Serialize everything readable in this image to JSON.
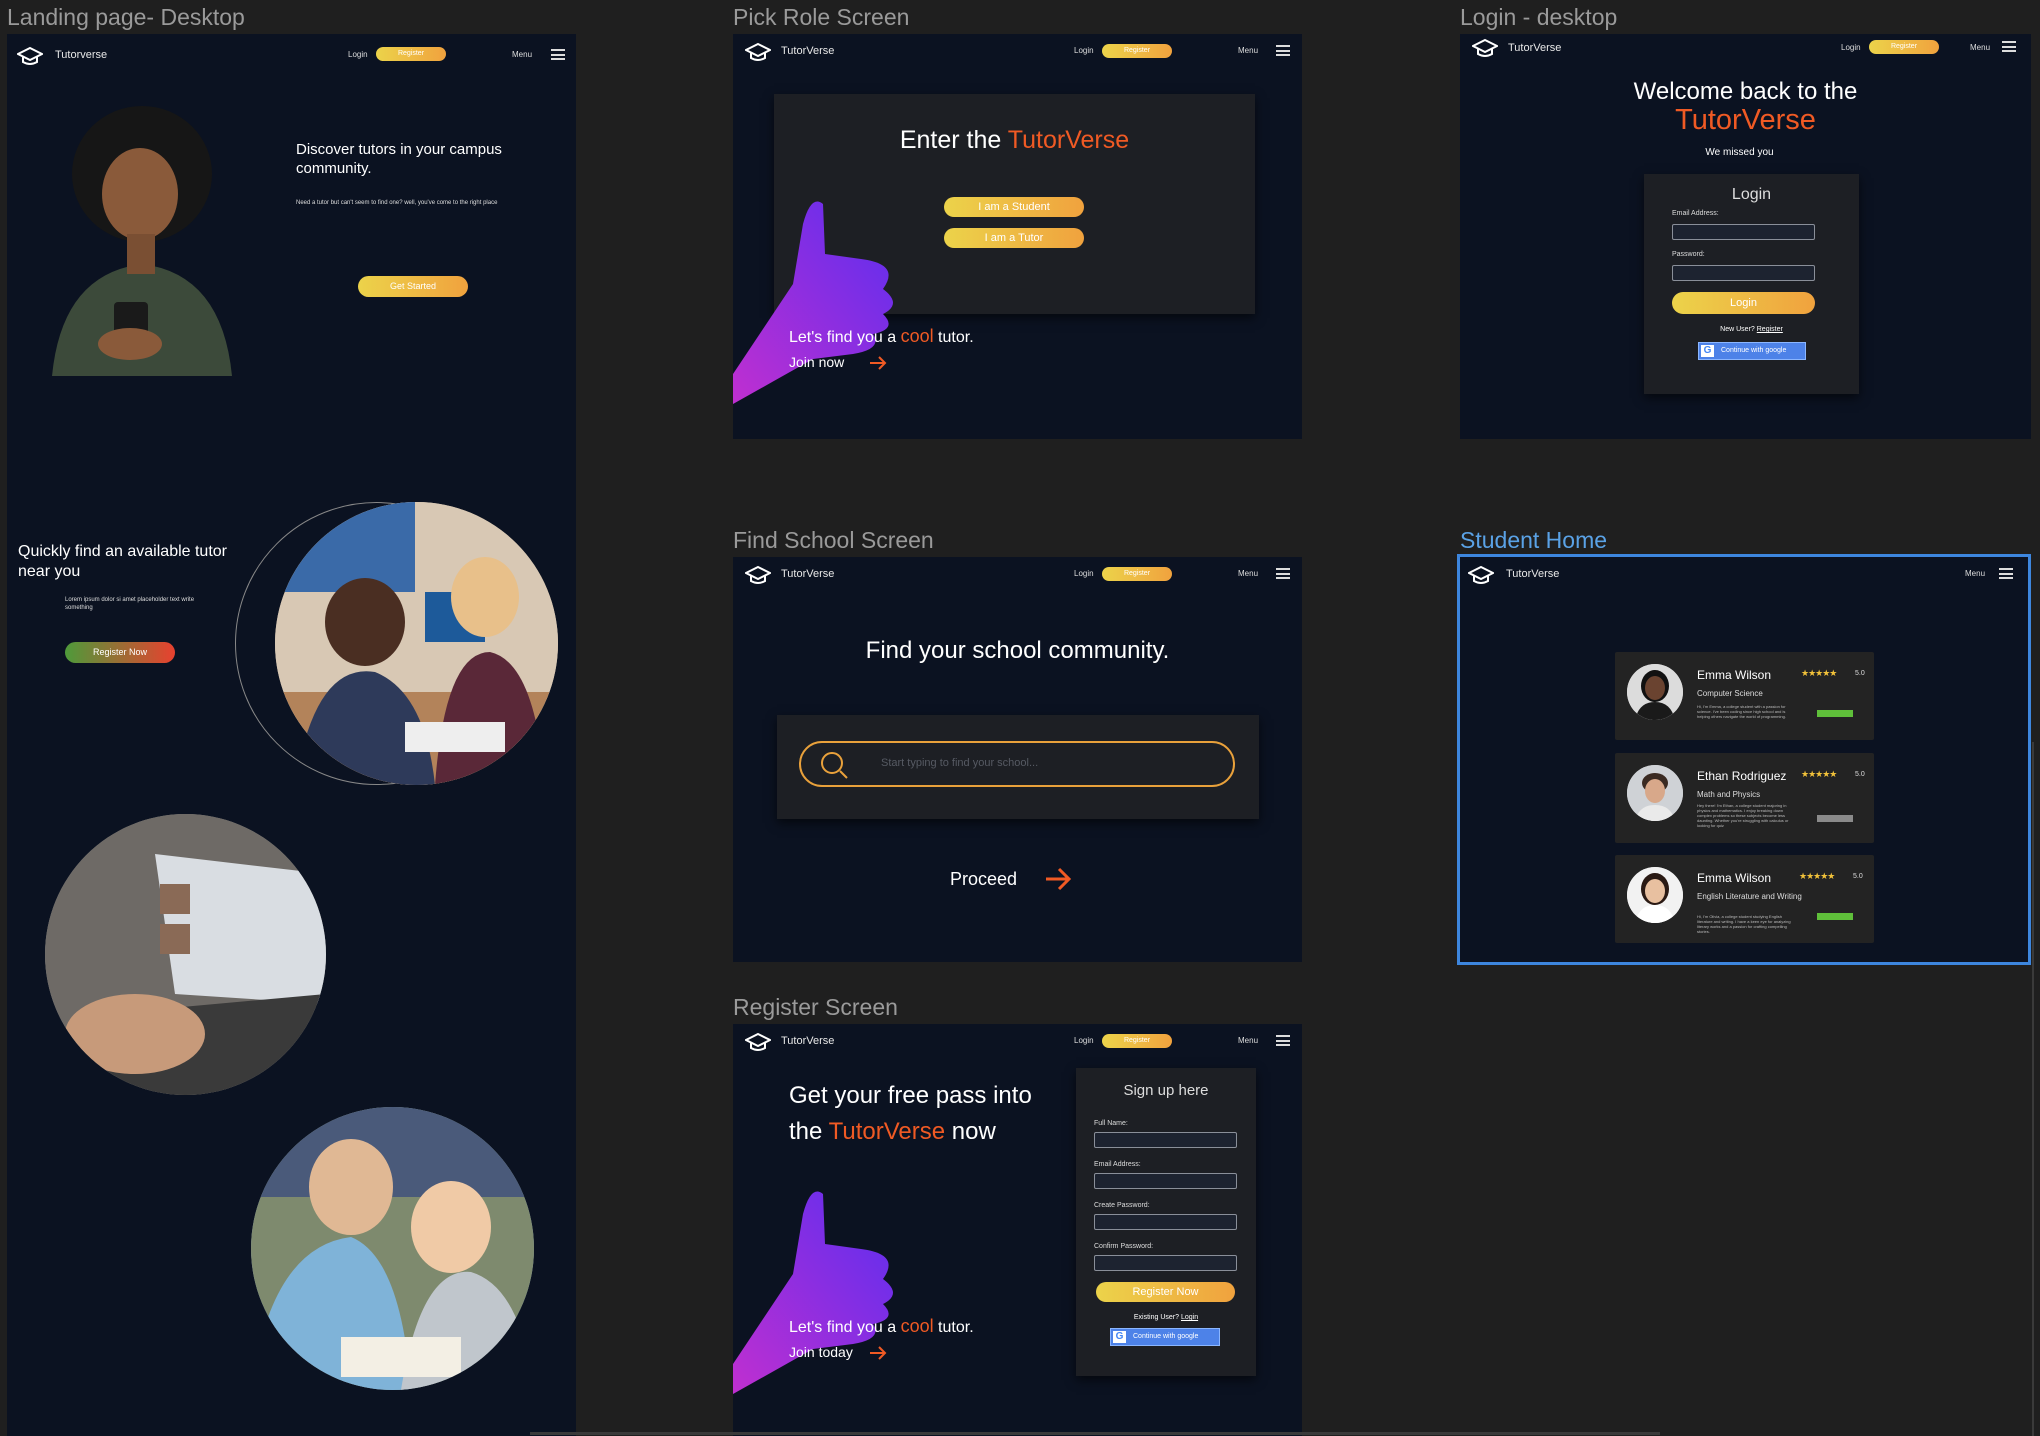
{
  "frames": {
    "landing": {
      "title": "Landing page- Desktop",
      "nav": {
        "brand": "Tutorverse",
        "login": "Login",
        "register": "Register",
        "menu": "Menu"
      },
      "hero_heading": "Discover tutors in your campus community.",
      "hero_text": "Need a tutor but can't seem to find one? well, you've come to the right place",
      "get_started": "Get Started",
      "section2_heading": "Quickly find an available tutor near you",
      "section2_text": "Lorem ipsum dolor si amet placeholder text write something",
      "register_now": "Register Now"
    },
    "pick_role": {
      "title": "Pick Role Screen",
      "nav": {
        "brand": "TutorVerse",
        "login": "Login",
        "register": "Register",
        "menu": "Menu"
      },
      "heading_pre": "Enter the ",
      "heading_brand": "TutorVerse",
      "student_btn": "I am a Student",
      "tutor_btn": "I am a Tutor",
      "tagline_pre": "Let's find you a ",
      "tagline_cool": "cool",
      "tagline_post": " tutor.",
      "join": "Join now"
    },
    "login": {
      "title": "Login - desktop",
      "nav": {
        "brand": "TutorVerse",
        "login": "Login",
        "register": "Register",
        "menu": "Menu"
      },
      "heading": "Welcome back to the",
      "brand": "TutorVerse",
      "sub": "We missed you",
      "card_title": "Login",
      "email_label": "Email Address:",
      "password_label": "Password:",
      "login_btn": "Login",
      "new_user": "New User?",
      "register_link": "Register",
      "google": "Continue with google"
    },
    "find_school": {
      "title": "Find School Screen",
      "nav": {
        "brand": "TutorVerse",
        "login": "Login",
        "register": "Register",
        "menu": "Menu"
      },
      "heading": "Find your school community.",
      "search_placeholder": "Start typing to find your school...",
      "proceed": "Proceed"
    },
    "student_home": {
      "title": "Student Home",
      "nav": {
        "brand": "TutorVerse",
        "menu": "Menu"
      },
      "tutors": [
        {
          "name": "Emma Wilson",
          "subject": "Computer Science",
          "stars": "★★★★★",
          "rating": "5.0",
          "desc": "Hi, I'm Emma, a college student with a passion for science. I've been coding since high school and is helping others navigate the world of programming.",
          "status_color": "#5fbf3a"
        },
        {
          "name": "Ethan Rodriguez",
          "subject": "Math and Physics",
          "stars": "★★★★★",
          "rating": "5.0",
          "desc": "Hey there! I'm Ethan, a college student majoring in physics and mathematics. I enjoy breaking down complex problems so these subjects become less daunting. Whether you're struggling with calculus or looking for quiz",
          "status_color": "#8a8a8a"
        },
        {
          "name": "Emma Wilson",
          "subject": "English Literature and Writing",
          "stars": "★★★★★",
          "rating": "5.0",
          "desc": "Hi, I'm Olivia, a college student studying English literature and writing. I have a keen eye for analyzing literary works and a passion for crafting compelling stories.",
          "status_color": "#5fbf3a"
        }
      ]
    },
    "register": {
      "title": "Register Screen",
      "nav": {
        "brand": "TutorVerse",
        "login": "Login",
        "register": "Register",
        "menu": "Menu"
      },
      "heading_line1": "Get your free pass into",
      "heading_pre": "the ",
      "heading_brand": "TutorVerse",
      "heading_post": " now",
      "tagline_pre": "Let's find you a ",
      "tagline_cool": "cool",
      "tagline_post": " tutor.",
      "join": "Join today",
      "card_title": "Sign up here",
      "full_name_label": "Full Name:",
      "email_label": "Email Address:",
      "create_password_label": "Create Password:",
      "confirm_password_label": "Confirm Password:",
      "register_btn": "Register Now",
      "existing_user": "Existing User?",
      "login_link": "Login",
      "google": "Continue with google"
    }
  },
  "colors": {
    "accent_orange": "#f05a24",
    "gold_start": "#ecd34a",
    "gold_end": "#f0a23e",
    "frame_bg": "#0b1221",
    "canvas_bg": "#1f1f1f",
    "selection_blue": "#3d86de"
  }
}
